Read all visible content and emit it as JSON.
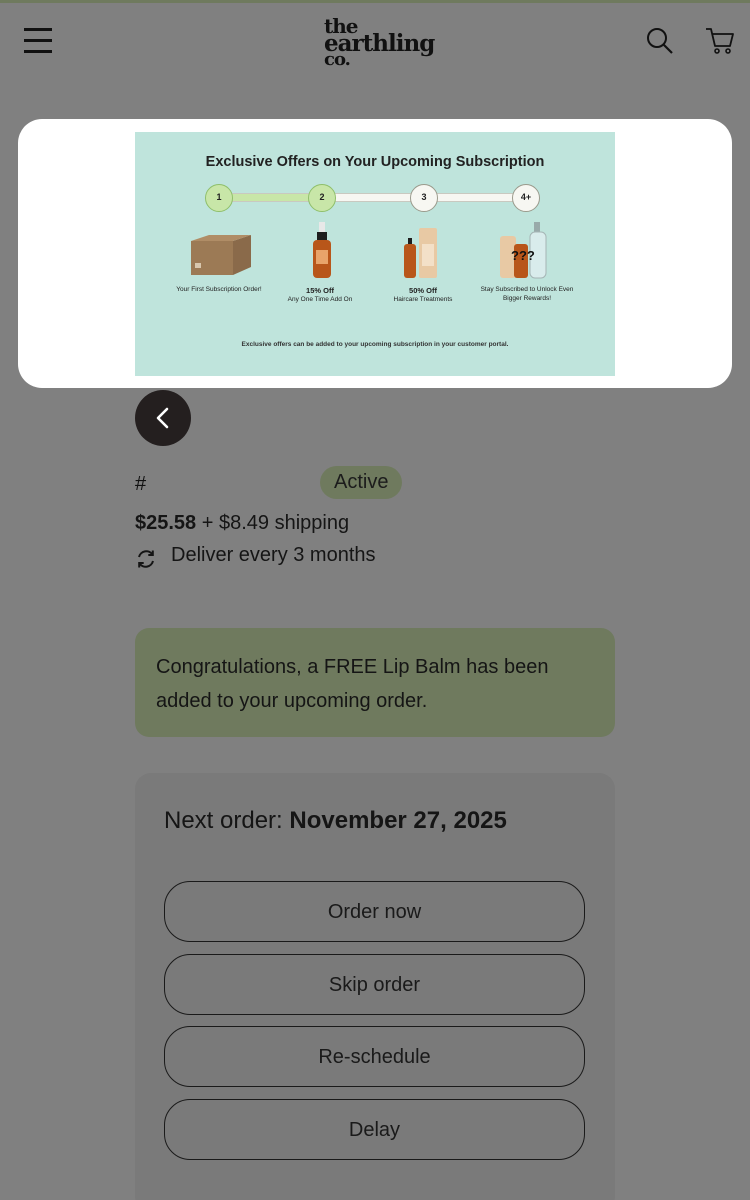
{
  "header": {
    "logo_line1": "the",
    "logo_line2": "earthling",
    "logo_line3": "co."
  },
  "popup": {
    "title": "Exclusive Offers on Your Upcoming Subscription",
    "progress_fraction": 0.33,
    "steps": [
      "1",
      "2",
      "3",
      "4+"
    ],
    "offers": [
      {
        "title": "",
        "lines": "Your First Subscription Order!"
      },
      {
        "title": "15% Off",
        "lines": "Any One Time Add On"
      },
      {
        "title": "50% Off",
        "lines": "Haircare Treatments"
      },
      {
        "title": "",
        "lines": "Stay Subscribed to Unlock Even Bigger Rewards!"
      }
    ],
    "mystery_text": "???",
    "footer": "Exclusive offers can be added to your upcoming subscription in your customer portal.",
    "bg_color": "#bfe4dc"
  },
  "subscription": {
    "hash": "#",
    "status": "Active",
    "price": "$25.58",
    "shipping": " + $8.49 shipping",
    "frequency": "Deliver every 3 months"
  },
  "notice": {
    "text": "Congratulations, a FREE Lip Balm has been added to your upcoming order."
  },
  "order": {
    "next_label": "Next order: ",
    "next_date": "November 27, 2025",
    "buttons": [
      "Order now",
      "Skip order",
      "Re-schedule",
      "Delay"
    ]
  },
  "colors": {
    "overlay": "#808080",
    "badge": "#6f7a5e",
    "notice": "#6f7a5e",
    "back_button": "#241f1f"
  }
}
